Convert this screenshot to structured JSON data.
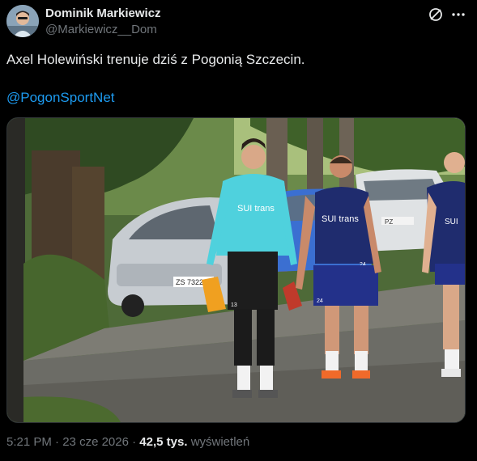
{
  "author": {
    "display_name": "Dominik Markiewicz",
    "handle": "@Markiewicz__Dom"
  },
  "tweet": {
    "text": "Axel Holewiński trenuje dziś z Pogonią Szczecin.",
    "mention": "@PogonSportNet"
  },
  "photo": {
    "plates": [
      "ZS 73223",
      "PZ"
    ],
    "shirt_text": [
      "SUI trans",
      "SUI trans",
      "SUI"
    ],
    "shirt_numbers": [
      "24",
      "24"
    ],
    "shorts_numbers": [
      "13"
    ]
  },
  "meta": {
    "time": "5:21 PM",
    "separator": "·",
    "date": "23 cze 2026",
    "views_count": "42,5 tys.",
    "views_label": "wyświetleń"
  },
  "icons": {
    "grok": "grok-icon",
    "more": "more-icon"
  },
  "colors": {
    "background": "#000000",
    "text": "#e7e9ea",
    "secondary": "#71767b",
    "link": "#1d9bf0"
  }
}
